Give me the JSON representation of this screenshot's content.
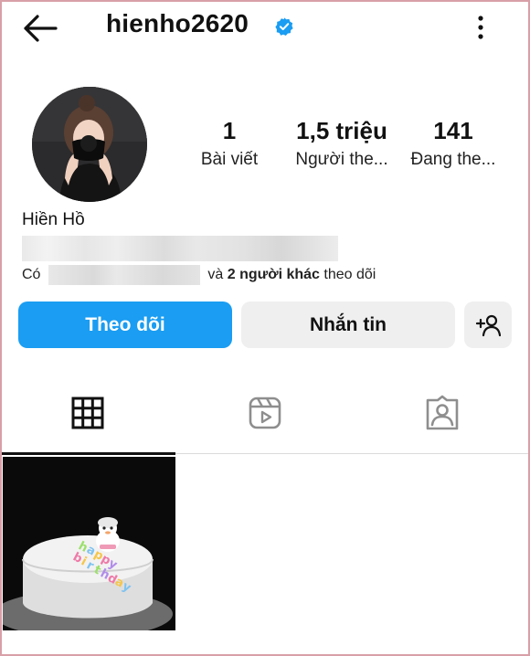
{
  "header": {
    "username": "hienho2620",
    "back_icon": "arrow-left-icon",
    "verified_icon": "verified-badge-icon",
    "more_icon": "more-vertical-icon"
  },
  "profile": {
    "display_name": "Hiền Hồ",
    "stats": [
      {
        "value": "1",
        "label": "Bài viết"
      },
      {
        "value": "1,5 triệu",
        "label": "Người the..."
      },
      {
        "value": "141",
        "label": "Đang the..."
      }
    ],
    "mutuals": {
      "prefix": "Có",
      "connector": "và",
      "others": "2 người khác",
      "suffix": "theo dõi"
    }
  },
  "actions": {
    "follow_label": "Theo dõi",
    "message_label": "Nhắn tin",
    "add_user_icon": "add-user-icon"
  },
  "tabs": [
    {
      "name": "grid",
      "icon": "grid-icon",
      "active": true
    },
    {
      "name": "reels",
      "icon": "reels-icon",
      "active": false
    },
    {
      "name": "tagged",
      "icon": "tagged-icon",
      "active": false
    }
  ],
  "colors": {
    "primary_button": "#1a9df2",
    "secondary_button": "#efefef",
    "verified": "#1a9df2"
  }
}
